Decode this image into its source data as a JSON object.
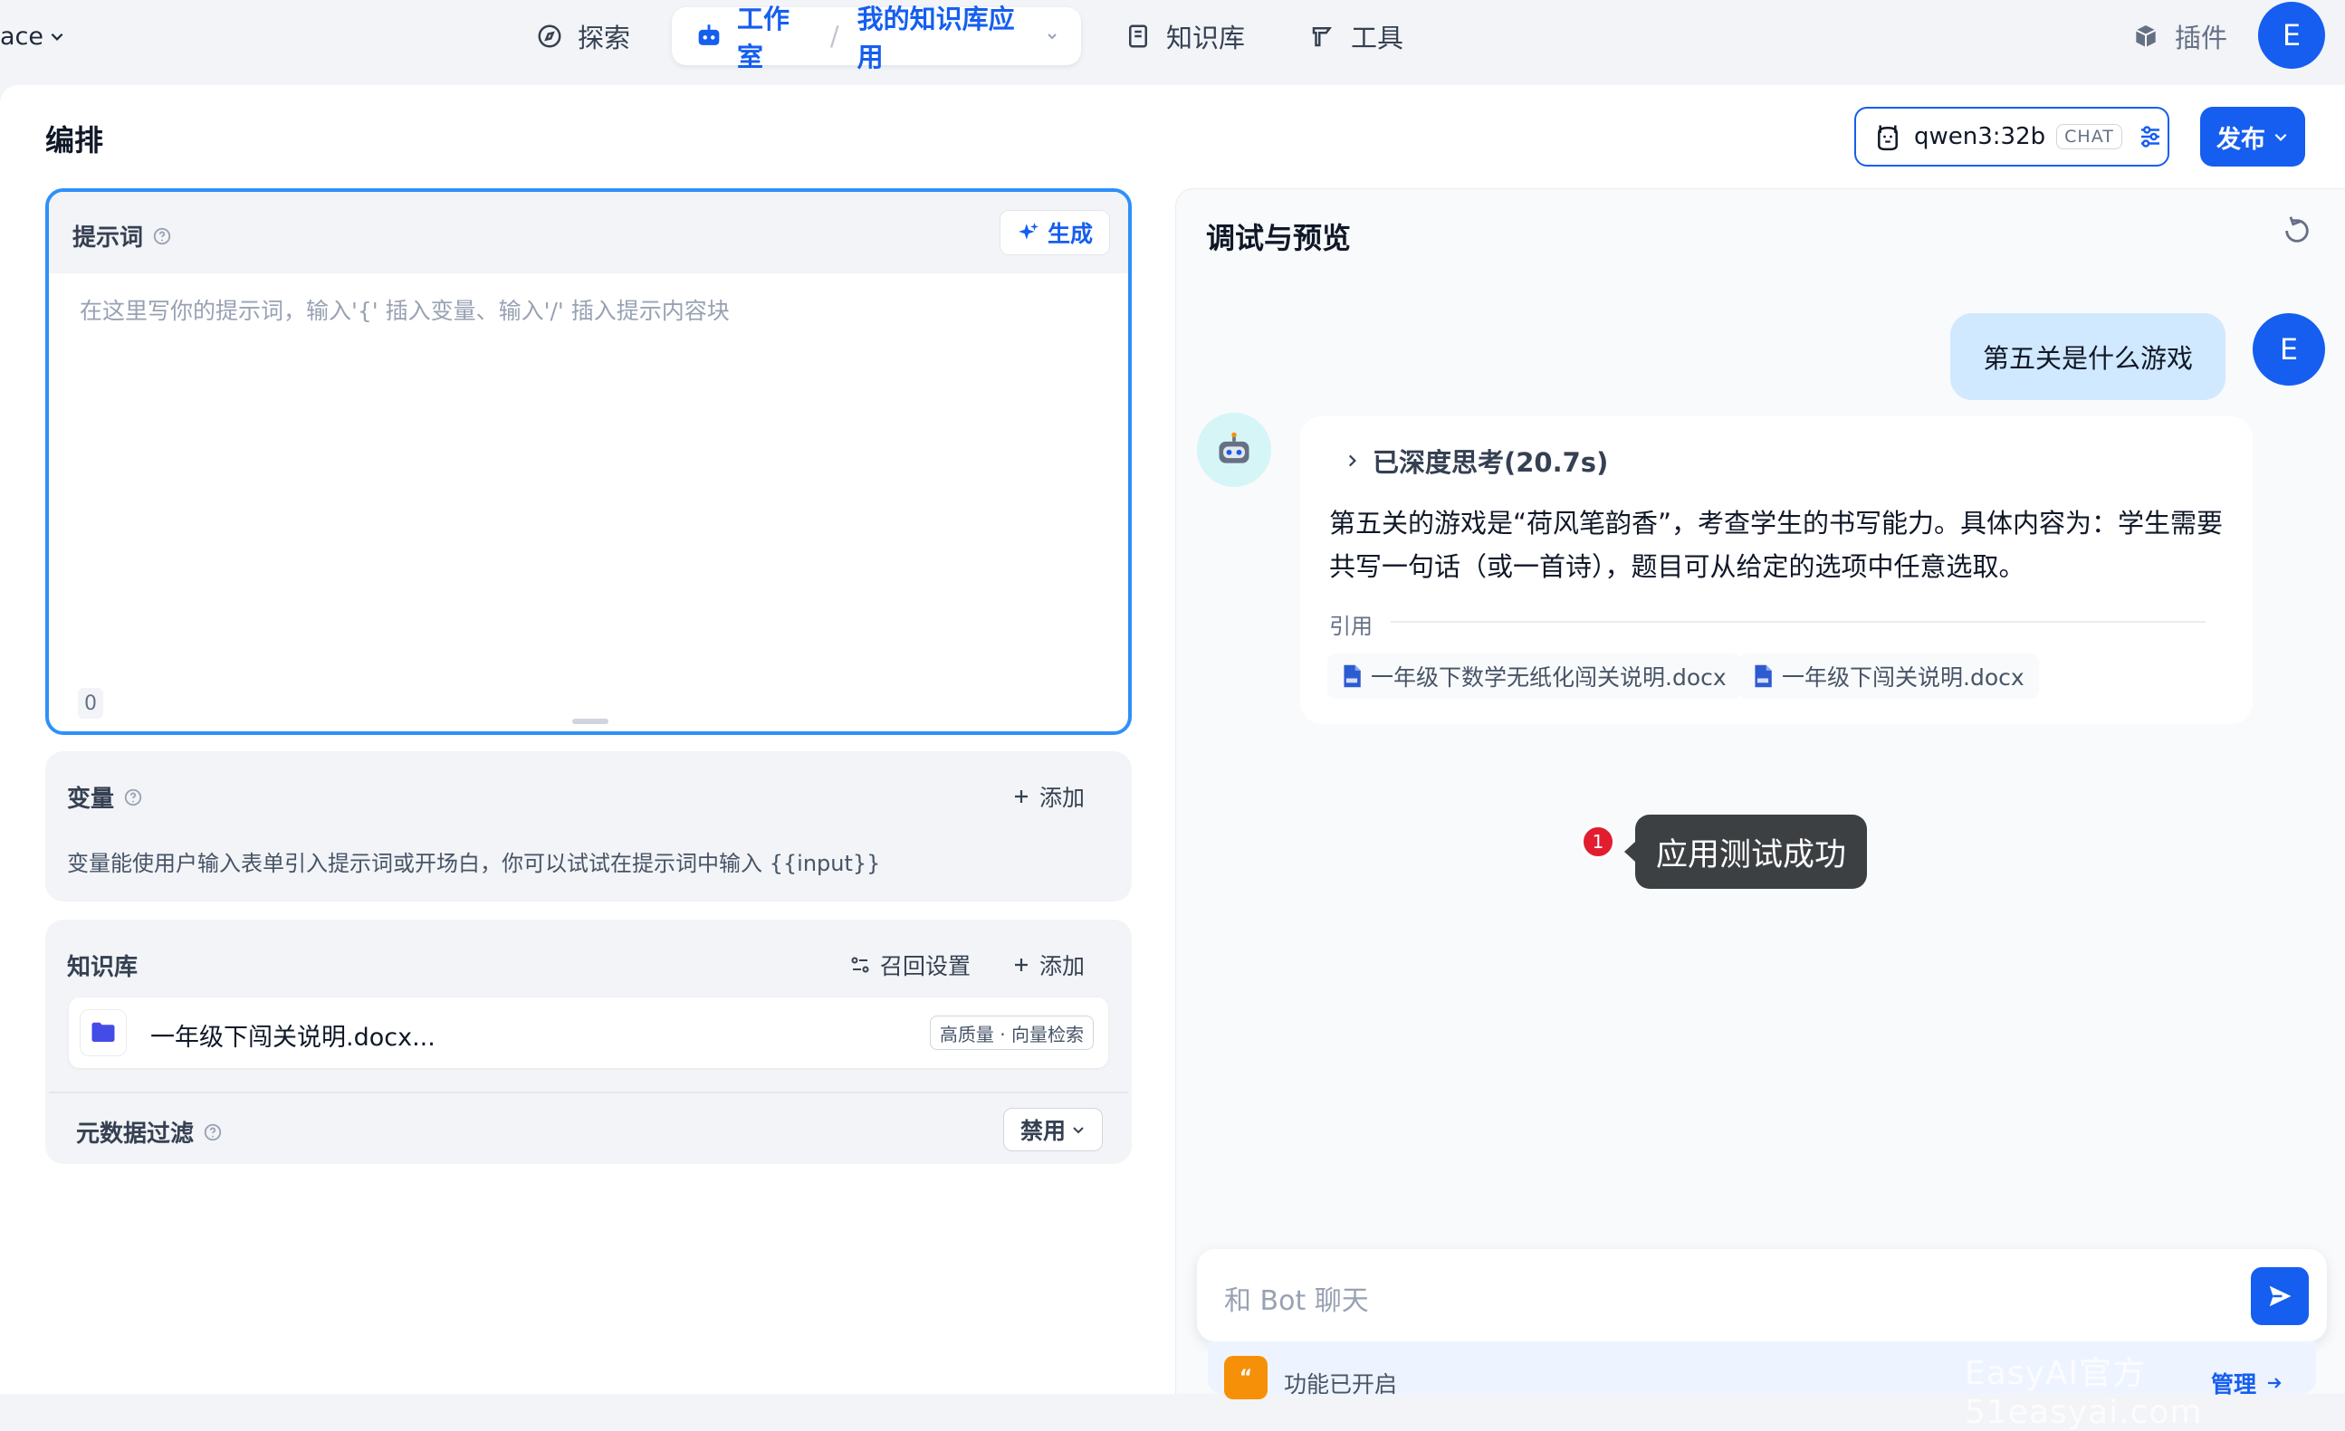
{
  "nav": {
    "workspace_label": "ace",
    "explore": "探索",
    "studio": "工作室",
    "app_name": "我的知识库应用",
    "knowledge": "知识库",
    "tools": "工具",
    "plugins": "插件",
    "avatar_letter": "E"
  },
  "header": {
    "title": "编排",
    "model_name": "qwen3:32b",
    "model_badge": "CHAT",
    "publish": "发布"
  },
  "prompt": {
    "label": "提示词",
    "generate": "生成",
    "placeholder": "在这里写你的提示词，输入'{' 插入变量、输入'/' 插入提示内容块",
    "char_count": "0"
  },
  "variables": {
    "title": "变量",
    "add": "添加",
    "description": "变量能使用户输入表单引入提示词或开场白，你可以试试在提示词中输入 {{input}}"
  },
  "knowledge": {
    "title": "知识库",
    "recall_settings": "召回设置",
    "add": "添加",
    "item_name": "一年级下闯关说明.docx...",
    "item_tag": "高质量 · 向量检索",
    "metadata_filter": "元数据过滤",
    "filter_value": "禁用"
  },
  "debug": {
    "title": "调试与预览",
    "user_message": "第五关是什么游戏",
    "user_avatar": "E",
    "thinking": "已深度思考(20.7s)",
    "answer": "第五关的游戏是“荷风笔韵香”，考查学生的书写能力。具体内容为：学生需要共写一句话（或一首诗），题目可从给定的选项中任意选取。",
    "citation_label": "引用",
    "citations": [
      "一年级下数学无纸化闯关说明.docx",
      "一年级下闯关说明.docx"
    ],
    "toast_badge": "1",
    "toast_text": "应用测试成功",
    "chat_placeholder": "和 Bot 聊天",
    "feature_status": "功能已开启",
    "manage": "管理",
    "watermark": "EasyAI官方51easyai.com"
  },
  "colors": {
    "accent": "#155eef",
    "prompt_border": "#2e90fa",
    "toast_bg": "#3d4042",
    "badge_red": "#e11d2f"
  }
}
